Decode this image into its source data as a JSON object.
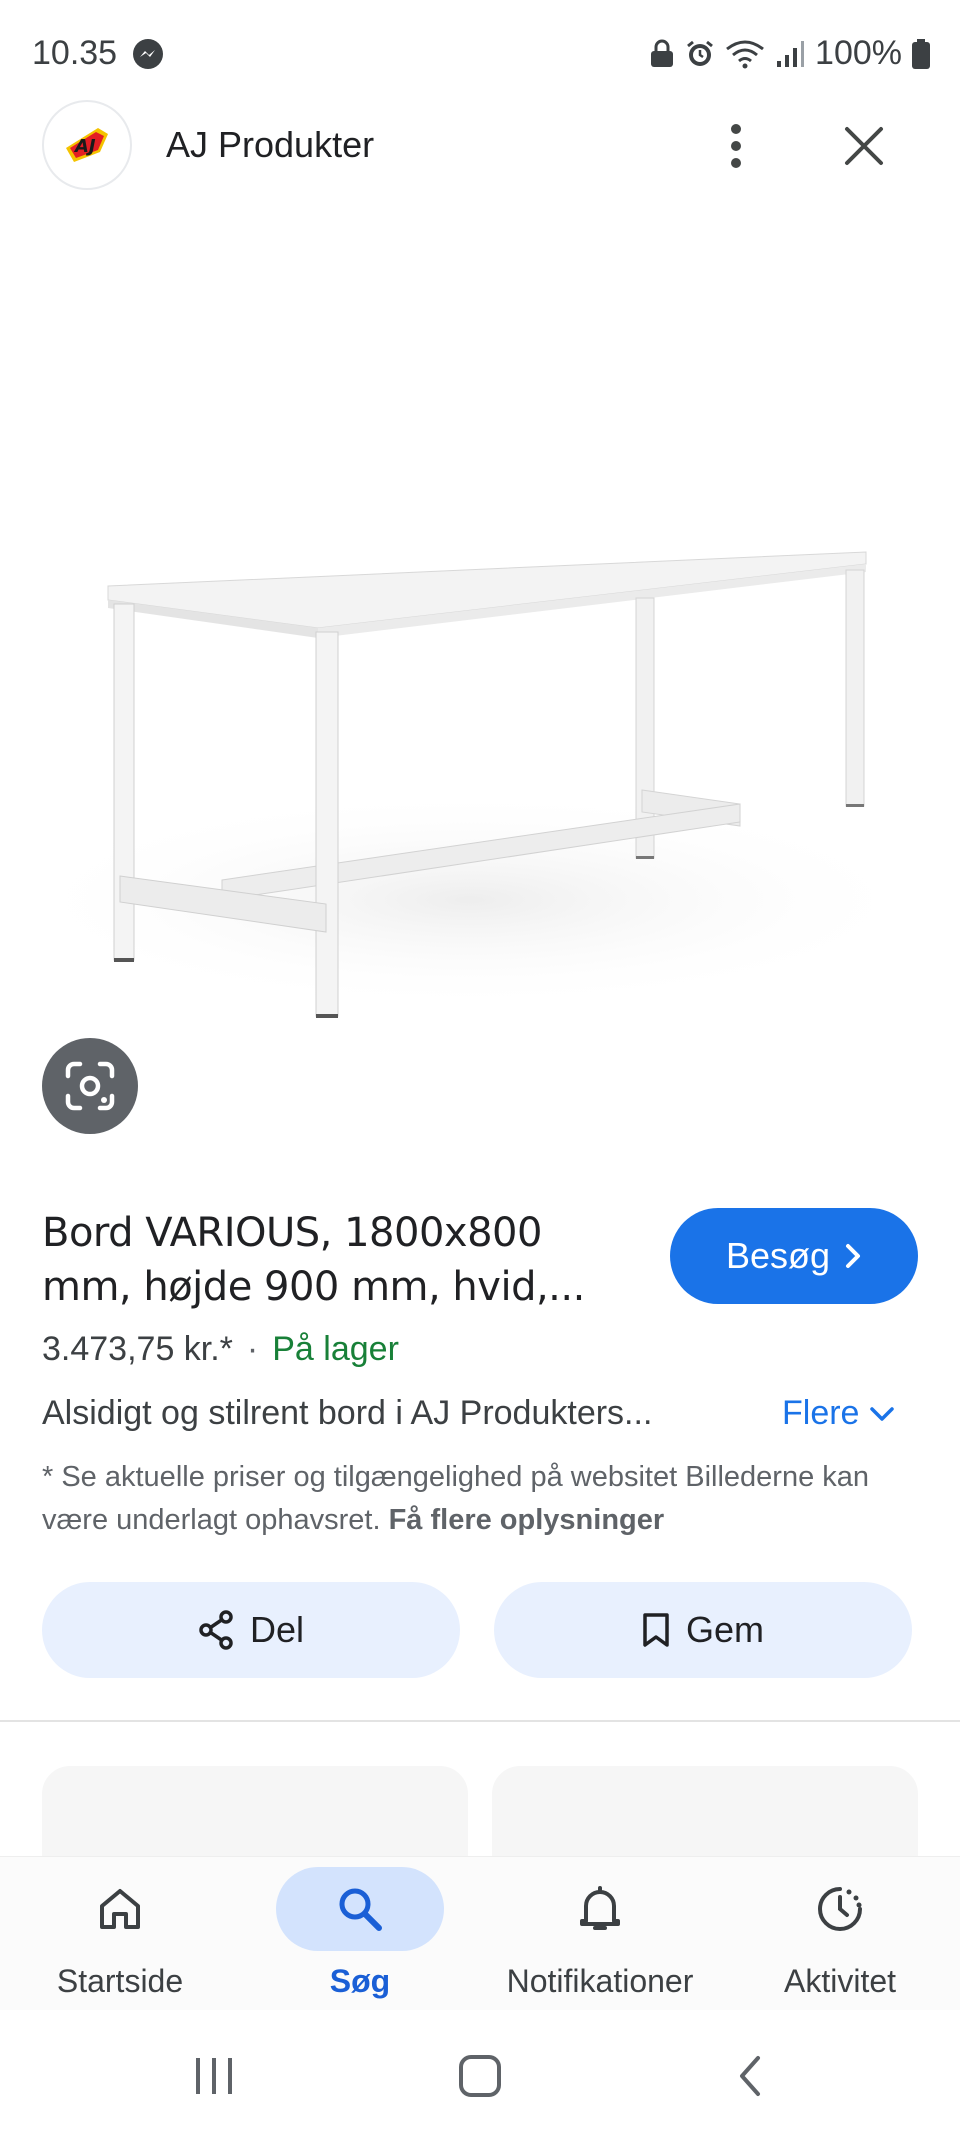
{
  "status_bar": {
    "time": "10.35",
    "battery": "100%"
  },
  "header": {
    "site_name": "AJ Produkter",
    "logo_text": "AJ"
  },
  "product": {
    "title": "Bord VARIOUS, 1800x800 mm, højde 900 mm, hvid,...",
    "visit_label": "Besøg",
    "price": "3.473,75 kr.*",
    "separator": "·",
    "stock": "På lager",
    "description": "Alsidigt og stilrent bord i AJ Produkters...",
    "more_label": "Flere",
    "disclaimer": "* Se aktuelle priser og tilgængelighed på websitet Billederne kan være underlagt ophavsret.",
    "disclaimer_link": "Få flere oplysninger"
  },
  "actions": {
    "share_label": "Del",
    "save_label": "Gem"
  },
  "bottom_nav": {
    "items": [
      {
        "label": "Startside",
        "icon": "home-icon"
      },
      {
        "label": "Søg",
        "icon": "search-icon",
        "active": true
      },
      {
        "label": "Notifikationer",
        "icon": "bell-icon"
      },
      {
        "label": "Aktivitet",
        "icon": "activity-icon"
      }
    ]
  },
  "colors": {
    "accent": "#1a73e8",
    "stock": "#188038",
    "pill": "#e8f0fe",
    "nav_active": "#d3e3fd"
  }
}
